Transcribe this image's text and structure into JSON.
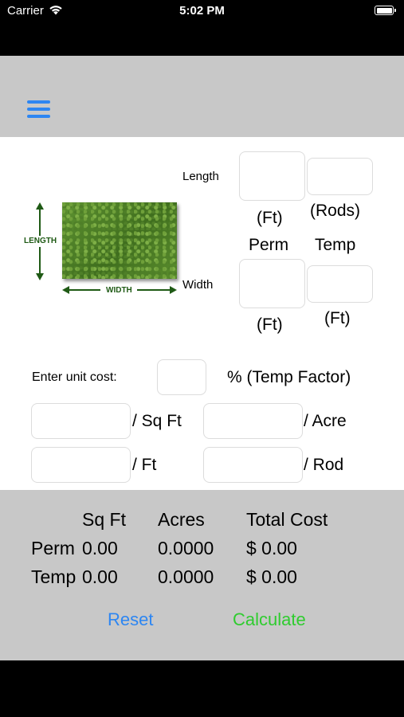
{
  "status_bar": {
    "carrier": "Carrier",
    "time": "5:02 PM"
  },
  "diagram": {
    "length_label": "LENGTH",
    "width_label": "WIDTH"
  },
  "dimensions": {
    "length_label": "Length",
    "width_label": "Width",
    "perm_label": "Perm",
    "temp_label": "Temp",
    "ft_unit": "(Ft)",
    "rods_unit": "(Rods)",
    "length_ft_value": "",
    "length_rods_value": "",
    "width_perm_value": "",
    "width_temp_value": ""
  },
  "costs": {
    "unit_cost_label": "Enter unit cost:",
    "temp_factor_value": "",
    "temp_factor_label": "% (Temp Factor)",
    "sqft_label": "/ Sq Ft",
    "acre_label": "/ Acre",
    "ft_label": "/ Ft",
    "rod_label": "/ Rod",
    "sqft_value": "",
    "acre_value": "",
    "ft_value": "",
    "rod_value": ""
  },
  "results": {
    "headers": {
      "sqft": "Sq Ft",
      "acres": "Acres",
      "total_cost": "Total Cost"
    },
    "rows": [
      {
        "label": "Perm",
        "sqft": "0.00",
        "acres": "0.0000",
        "total": "$ 0.00"
      },
      {
        "label": "Temp",
        "sqft": "0.00",
        "acres": "0.0000",
        "total": "$ 0.00"
      }
    ]
  },
  "actions": {
    "reset": "Reset",
    "calculate": "Calculate"
  },
  "colors": {
    "accent_blue": "#2d86f2",
    "calculate_green": "#2fcc2f",
    "panel_gray": "#c8c8c8"
  },
  "icons": {
    "menu": "hamburger-menu-icon",
    "wifi": "wifi-icon",
    "battery": "battery-icon"
  }
}
